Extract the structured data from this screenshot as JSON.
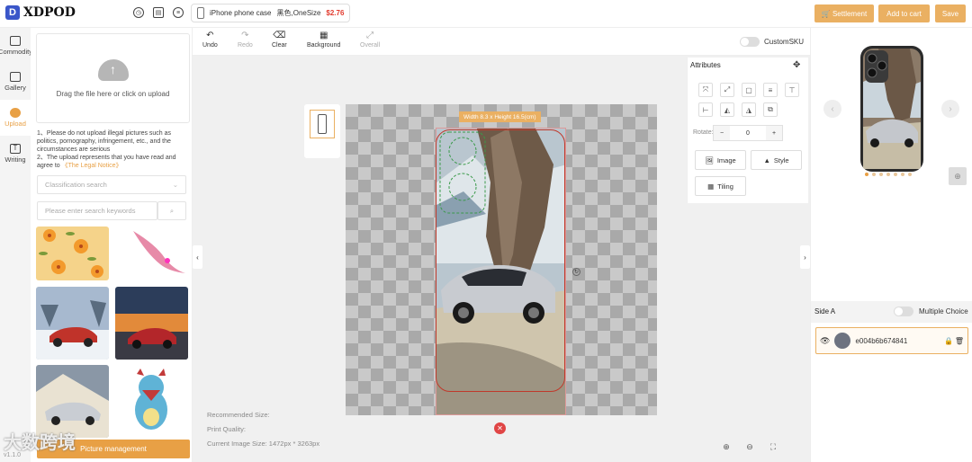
{
  "app": {
    "brand": "XDPOD",
    "logo_letter": "D"
  },
  "top_icons": [
    "clock-icon",
    "layers-icon",
    "list-icon"
  ],
  "product": {
    "name": "iPhone phone case",
    "variant": "黑色,OneSize",
    "price": "$2.76"
  },
  "top_buttons": {
    "settlement": "Settlement",
    "add_to_cart": "Add to cart",
    "save": "Save"
  },
  "nav": {
    "items": [
      {
        "label": "Commodity",
        "icon": "commodity-icon"
      },
      {
        "label": "Gallery",
        "icon": "gallery-icon"
      },
      {
        "label": "Upload",
        "icon": "upload-icon",
        "active": true
      },
      {
        "label": "Writing",
        "icon": "text-icon"
      }
    ]
  },
  "upload": {
    "drop_text": "Drag the file here or click on upload",
    "notice_1": "1、Please do not upload illegal pictures such as politics, pornography, infringement, etc., and the circumstances are serious",
    "notice_2": "2、The upload represents that you have read and agree to",
    "legal_link": "《The Legal Notice》",
    "classification_placeholder": "Classification search",
    "keyword_placeholder": "Please enter search keywords",
    "management_button": "Picture management"
  },
  "watermark": "大数跨境",
  "version": "v1.1.0",
  "toolbar": {
    "undo": "Undo",
    "redo": "Redo",
    "clear": "Clear",
    "background": "Background",
    "overall": "Overall",
    "custom_sku": "CustomSKU"
  },
  "canvas": {
    "size_label": "Width 8.3 x Height 16.5(cm)",
    "recommended_size_label": "Recommended Size:",
    "print_quality_label": "Print Quality:",
    "current_image_size_label": "Current Image Size:",
    "current_image_size_value": "1472px * 3263px"
  },
  "attributes": {
    "title": "Attributes",
    "rotate_label": "Rotate:",
    "rotate_value": "0",
    "image_button": "Image",
    "style_button": "Style",
    "tiling_button": "Tiling"
  },
  "right": {
    "side_label": "Side A",
    "multiple_choice": "Multiple Choice",
    "layer_name": "e004b6b674841",
    "carousel_total": 7,
    "carousel_active": 1
  },
  "colors": {
    "accent": "#e8a045",
    "price": "#e23b2e",
    "brand": "#3a56c9"
  }
}
